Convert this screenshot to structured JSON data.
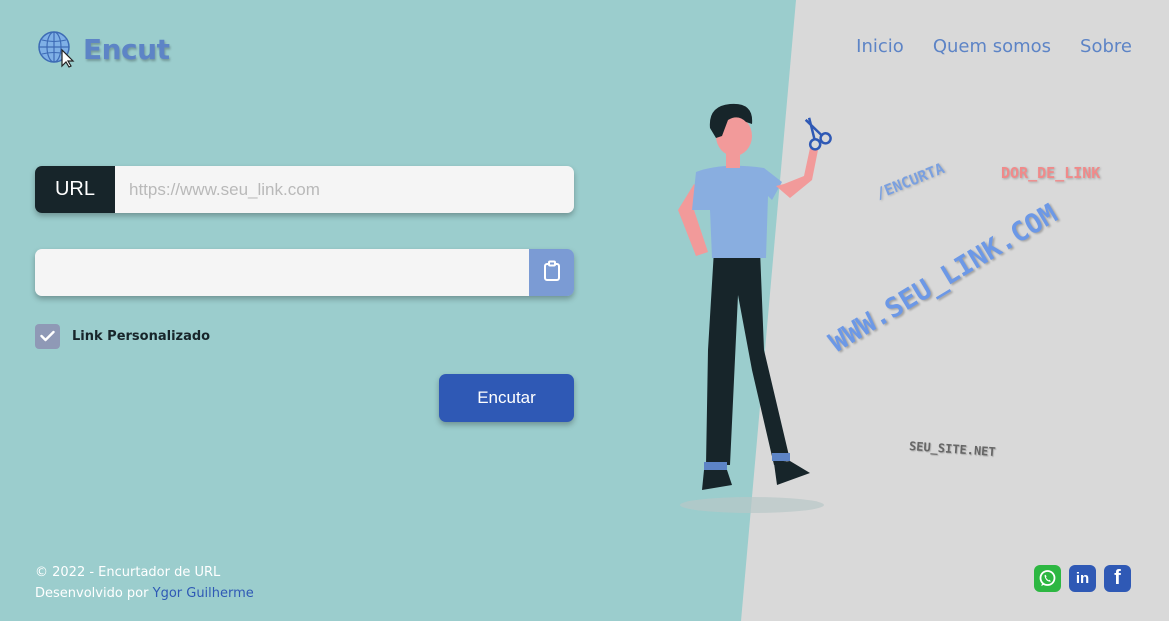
{
  "header": {
    "logo_text": "Encut",
    "nav": [
      {
        "label": "Inicio"
      },
      {
        "label": "Quem somos"
      },
      {
        "label": "Sobre"
      }
    ]
  },
  "form": {
    "url_label": "URL",
    "url_placeholder": "https://www.seu_link.com",
    "url_value": "",
    "result_value": "",
    "custom_link_label": "Link Personalizado",
    "custom_link_checked": true,
    "submit_label": "Encutar"
  },
  "illustration": {
    "words": [
      "/ENCURTA",
      "DOR_DE_LINK",
      "WWW.SEU_LINK.COM",
      "SEU_SITE.NET"
    ]
  },
  "footer": {
    "copyright": "© 2022 - Encurtador de URL",
    "developed_by": "Desenvolvido por",
    "author": "Ygor Guilherme"
  },
  "social": [
    {
      "icon": "whatsapp-icon",
      "color": "#2db742"
    },
    {
      "icon": "linkedin-icon",
      "color": "#2f59b5",
      "text": "in"
    },
    {
      "icon": "facebook-icon",
      "color": "#2f59b5",
      "text": "f"
    }
  ],
  "colors": {
    "teal_bg": "#9bcdcd",
    "gray_bg": "#d9d9d9",
    "accent": "#2f59b5",
    "dark": "#17252a"
  }
}
